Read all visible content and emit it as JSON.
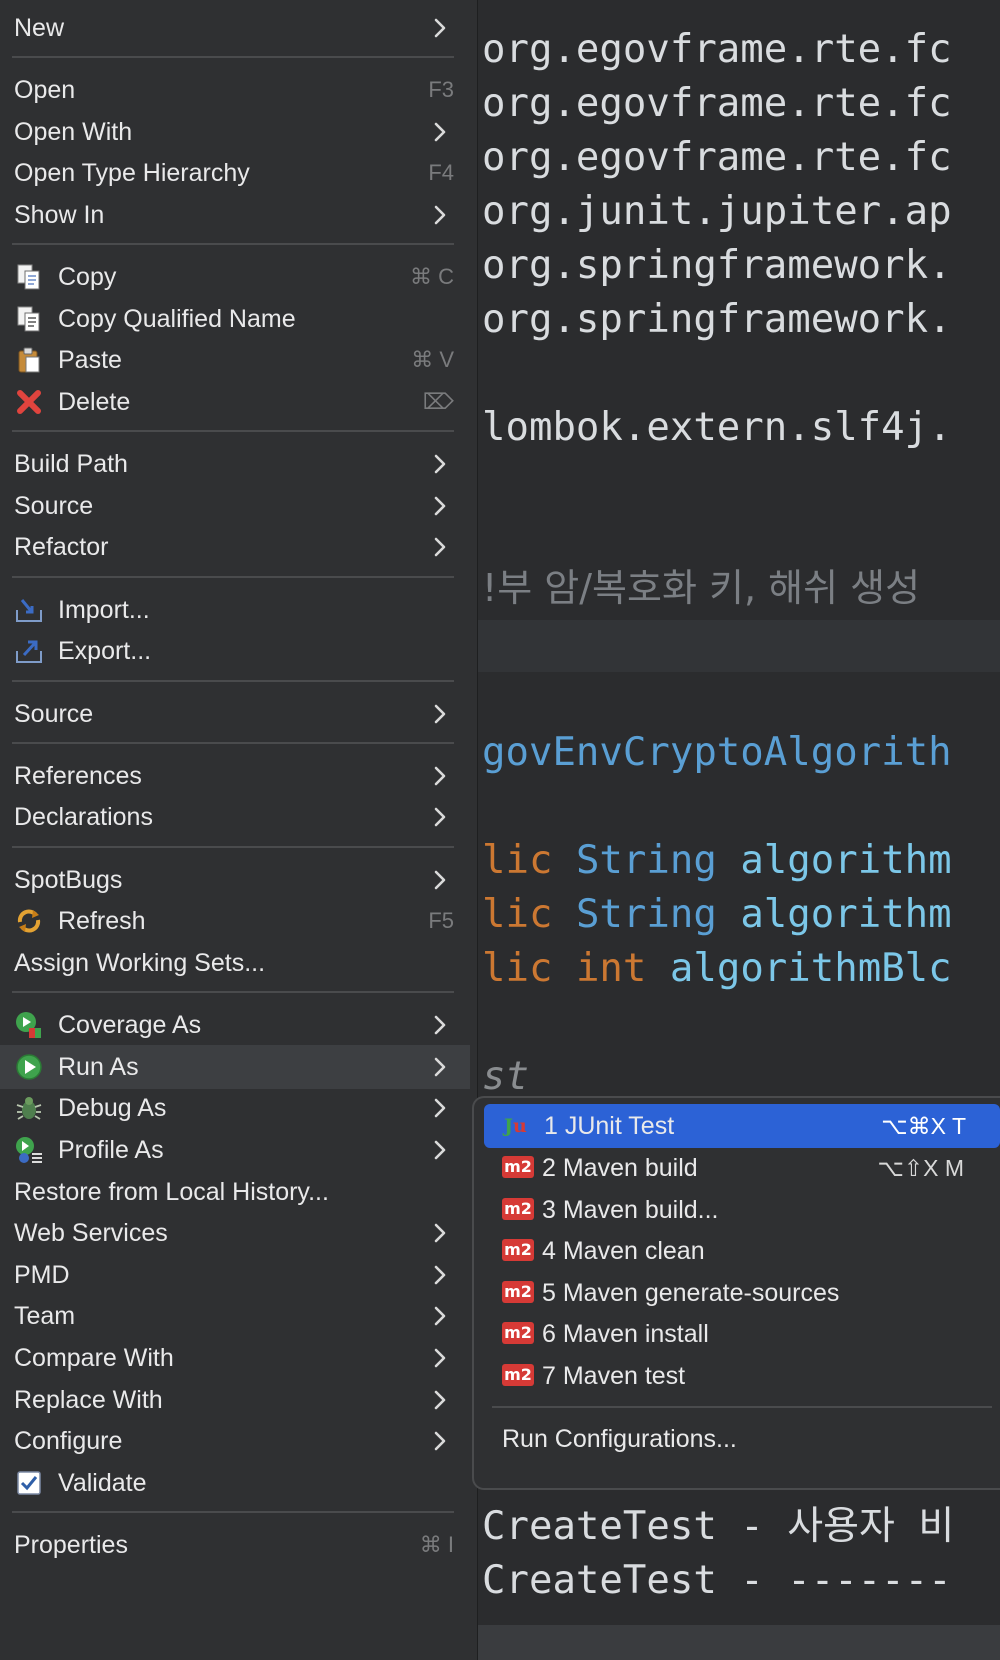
{
  "editor": {
    "lines": [
      "org.egovframe.rte.fc",
      "org.egovframe.rte.fc",
      "org.egovframe.rte.fc",
      "org.junit.jupiter.ap",
      "org.springframework.",
      "org.springframework.",
      "lombok.extern.slf4j.",
      "!부 암/복호화 키, 해쉬 생성",
      "govEnvCryptoAlgorith",
      "String",
      "algorithm",
      "String",
      "algorithm",
      "int",
      "algorithmBlc",
      "st",
      "CreateTest - 사용자 비",
      "CreateTest - -------",
      "lic",
      "lic",
      "lic"
    ]
  },
  "main_menu": {
    "items": [
      {
        "label": "New",
        "shortcut": "",
        "submenu": true,
        "icon": ""
      },
      {
        "label": "Open",
        "shortcut": "F3",
        "submenu": false,
        "icon": ""
      },
      {
        "label": "Open With",
        "shortcut": "",
        "submenu": true,
        "icon": ""
      },
      {
        "label": "Open Type Hierarchy",
        "shortcut": "F4",
        "submenu": false,
        "icon": ""
      },
      {
        "label": "Show In",
        "shortcut": "",
        "submenu": true,
        "icon": ""
      },
      {
        "label": "Copy",
        "shortcut": "⌘ C",
        "submenu": false,
        "icon": "copy-icon"
      },
      {
        "label": "Copy Qualified Name",
        "shortcut": "",
        "submenu": false,
        "icon": "copy-qualified-icon"
      },
      {
        "label": "Paste",
        "shortcut": "⌘ V",
        "submenu": false,
        "icon": "paste-icon"
      },
      {
        "label": "Delete",
        "shortcut": "⌦",
        "submenu": false,
        "icon": "delete-icon"
      },
      {
        "label": "Build Path",
        "shortcut": "",
        "submenu": true,
        "icon": ""
      },
      {
        "label": "Source",
        "shortcut": "",
        "submenu": true,
        "icon": ""
      },
      {
        "label": "Refactor",
        "shortcut": "",
        "submenu": true,
        "icon": ""
      },
      {
        "label": "Import...",
        "shortcut": "",
        "submenu": false,
        "icon": "import-icon"
      },
      {
        "label": "Export...",
        "shortcut": "",
        "submenu": false,
        "icon": "export-icon"
      },
      {
        "label": "Source",
        "shortcut": "",
        "submenu": true,
        "icon": ""
      },
      {
        "label": "References",
        "shortcut": "",
        "submenu": true,
        "icon": ""
      },
      {
        "label": "Declarations",
        "shortcut": "",
        "submenu": true,
        "icon": ""
      },
      {
        "label": "SpotBugs",
        "shortcut": "",
        "submenu": true,
        "icon": ""
      },
      {
        "label": "Refresh",
        "shortcut": "F5",
        "submenu": false,
        "icon": "refresh-icon"
      },
      {
        "label": "Assign Working Sets...",
        "shortcut": "",
        "submenu": false,
        "icon": ""
      },
      {
        "label": "Coverage As",
        "shortcut": "",
        "submenu": true,
        "icon": "coverage-icon"
      },
      {
        "label": "Run As",
        "shortcut": "",
        "submenu": true,
        "icon": "run-icon"
      },
      {
        "label": "Debug As",
        "shortcut": "",
        "submenu": true,
        "icon": "debug-bug-icon"
      },
      {
        "label": "Profile As",
        "shortcut": "",
        "submenu": true,
        "icon": "profile-icon"
      },
      {
        "label": "Restore from Local History...",
        "shortcut": "",
        "submenu": false,
        "icon": ""
      },
      {
        "label": "Web Services",
        "shortcut": "",
        "submenu": true,
        "icon": ""
      },
      {
        "label": "PMD",
        "shortcut": "",
        "submenu": true,
        "icon": ""
      },
      {
        "label": "Team",
        "shortcut": "",
        "submenu": true,
        "icon": ""
      },
      {
        "label": "Compare With",
        "shortcut": "",
        "submenu": true,
        "icon": ""
      },
      {
        "label": "Replace With",
        "shortcut": "",
        "submenu": true,
        "icon": ""
      },
      {
        "label": "Configure",
        "shortcut": "",
        "submenu": true,
        "icon": ""
      },
      {
        "label": "Validate",
        "shortcut": "",
        "submenu": false,
        "icon": "validate-checkbox-icon"
      },
      {
        "label": "Properties",
        "shortcut": "⌘ I",
        "submenu": false,
        "icon": ""
      }
    ]
  },
  "run_as_submenu": {
    "items": [
      {
        "label": "1 JUnit Test",
        "shortcut": "⌥⌘X T",
        "icon": "junit-icon",
        "badge": "Ju"
      },
      {
        "label": "2 Maven build",
        "shortcut": "⌥⇧X M",
        "icon": "maven-icon",
        "badge": "m2"
      },
      {
        "label": "3 Maven build...",
        "shortcut": "",
        "icon": "maven-icon",
        "badge": "m2"
      },
      {
        "label": "4 Maven clean",
        "shortcut": "",
        "icon": "maven-icon",
        "badge": "m2"
      },
      {
        "label": "5 Maven generate-sources",
        "shortcut": "",
        "icon": "maven-icon",
        "badge": "m2"
      },
      {
        "label": "6 Maven install",
        "shortcut": "",
        "icon": "maven-icon",
        "badge": "m2"
      },
      {
        "label": "7 Maven test",
        "shortcut": "",
        "icon": "maven-icon",
        "badge": "m2"
      },
      {
        "label": "Run Configurations...",
        "shortcut": "",
        "icon": "",
        "badge": ""
      }
    ]
  },
  "colors": {
    "menu_bg": "#2f3032",
    "selected_bg": "#2c62d6",
    "maven_red": "#d63a36",
    "keyword": "#cc7832",
    "type": "#5a9fd4"
  }
}
